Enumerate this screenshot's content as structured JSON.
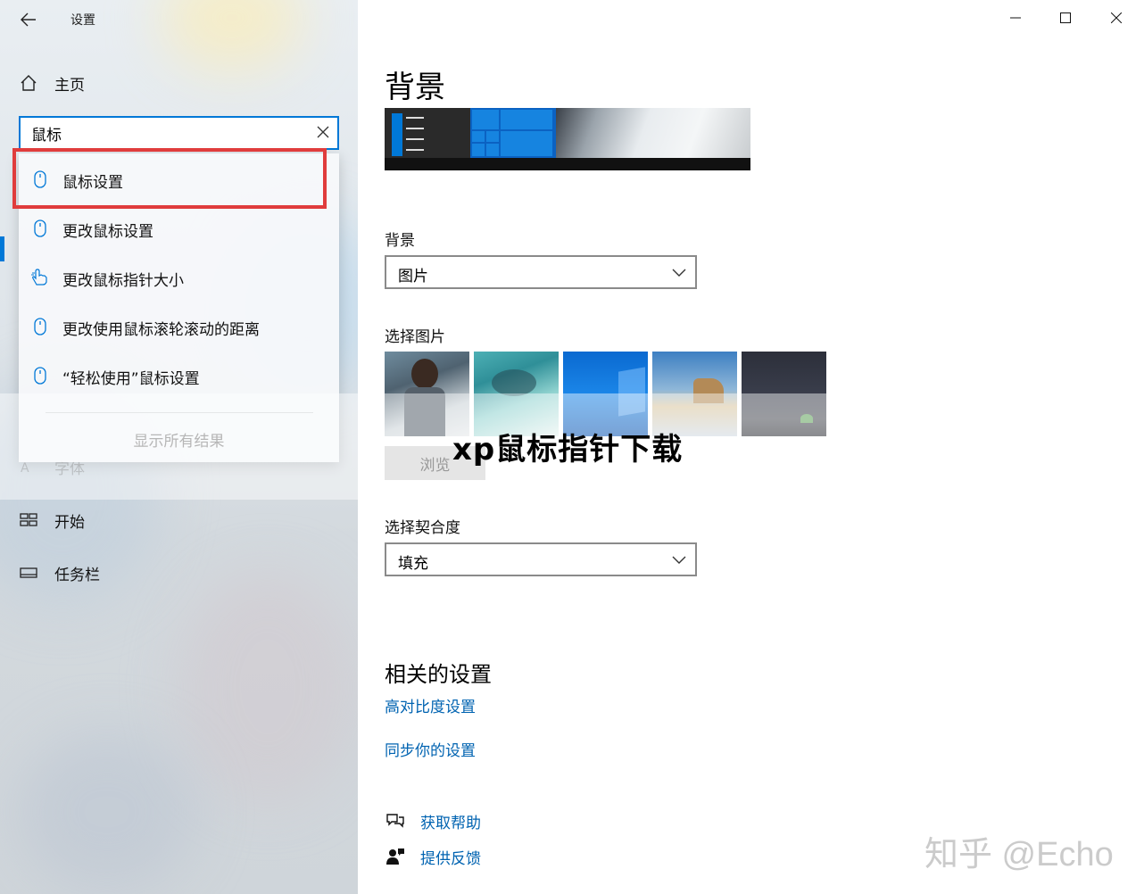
{
  "window": {
    "title": "设置",
    "minimize_glyph": "—",
    "maximize_glyph": "☐",
    "close_glyph": "✕"
  },
  "sidebar": {
    "home_label": "主页",
    "search": {
      "value": "鼠标",
      "placeholder": ""
    },
    "suggestions": [
      {
        "label": "鼠标设置",
        "icon": "mouse-icon"
      },
      {
        "label": "更改鼠标设置",
        "icon": "mouse-icon"
      },
      {
        "label": "更改鼠标指针大小",
        "icon": "hand-pointer-icon"
      },
      {
        "label": "更改使用鼠标滚轮滚动的距离",
        "icon": "mouse-icon"
      },
      {
        "label": "“轻松使用”鼠标设置",
        "icon": "mouse-icon"
      }
    ],
    "show_all_label": "显示所有结果",
    "items": [
      {
        "label": "字体",
        "icon": "font-icon"
      },
      {
        "label": "开始",
        "icon": "start-icon"
      },
      {
        "label": "任务栏",
        "icon": "taskbar-icon"
      }
    ]
  },
  "main": {
    "page_title": "背景",
    "background": {
      "label": "背景",
      "value": "图片"
    },
    "choose_picture": {
      "label": "选择图片",
      "browse_label": "浏览"
    },
    "fit": {
      "label": "选择契合度",
      "value": "填充"
    },
    "related": {
      "title": "相关的设置",
      "links": [
        "高对比度设置",
        "同步你的设置"
      ]
    },
    "help": {
      "get_help": "获取帮助",
      "feedback": "提供反馈"
    }
  },
  "overlay": {
    "title": "xp鼠标指针下载",
    "watermark": "知乎 @Echo"
  },
  "colors": {
    "accent": "#0078d7",
    "link": "#0063b1",
    "highlight_box": "#e03c3c"
  }
}
